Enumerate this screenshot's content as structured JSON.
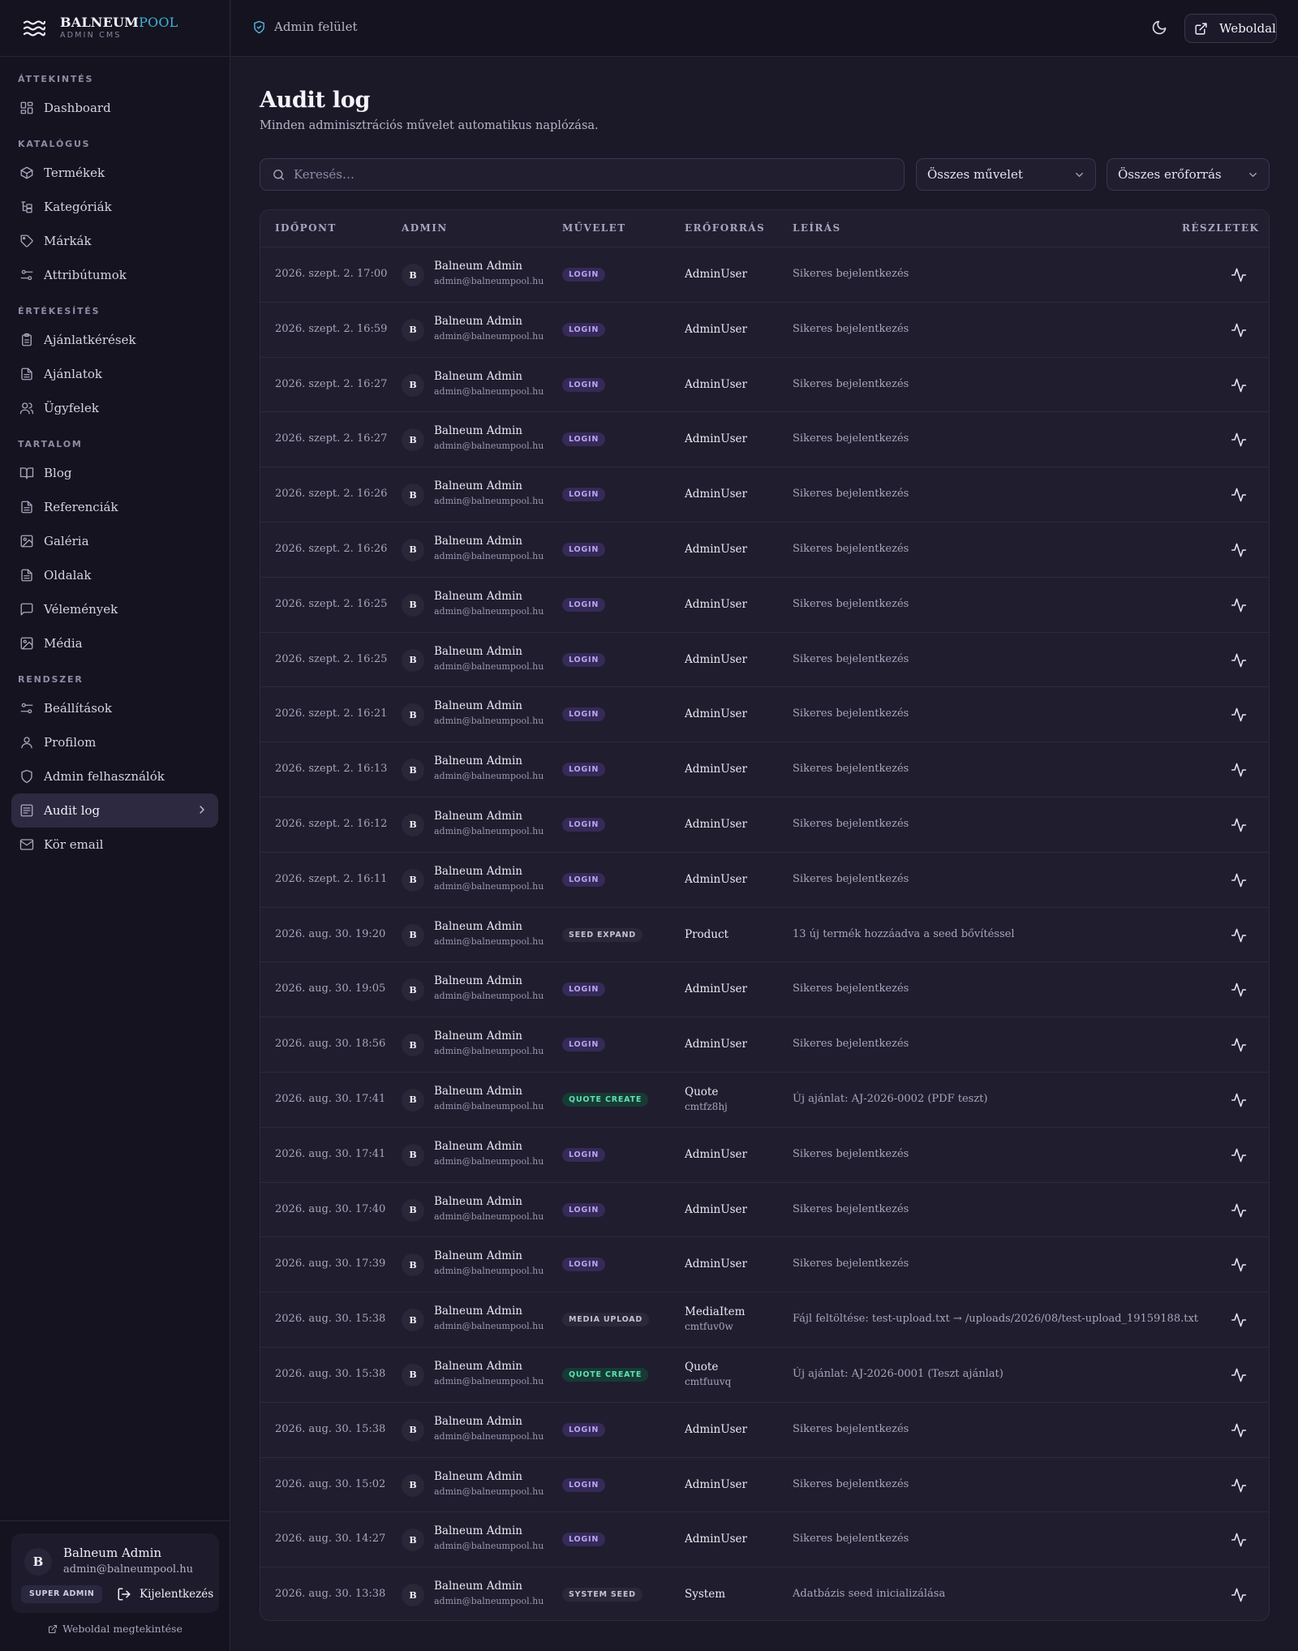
{
  "brand": {
    "name_a": "BALNEUM",
    "name_b": "POOL",
    "subtitle": "ADMIN CMS"
  },
  "sidebar": {
    "sections": [
      {
        "title": "ÁTTEKINTÉS",
        "items": [
          {
            "label": "Dashboard",
            "icon": "dashboard-icon"
          }
        ]
      },
      {
        "title": "KATALÓGUS",
        "items": [
          {
            "label": "Termékek",
            "icon": "package-icon"
          },
          {
            "label": "Kategóriák",
            "icon": "tree-icon"
          },
          {
            "label": "Márkák",
            "icon": "tag-icon"
          },
          {
            "label": "Attribútumok",
            "icon": "sliders-icon"
          }
        ]
      },
      {
        "title": "ÉRTÉKESÍTÉS",
        "items": [
          {
            "label": "Ajánlatkérések",
            "icon": "clipboard-icon"
          },
          {
            "label": "Ajánlatok",
            "icon": "file-icon"
          },
          {
            "label": "Ügyfelek",
            "icon": "users-icon"
          }
        ]
      },
      {
        "title": "TARTALOM",
        "items": [
          {
            "label": "Blog",
            "icon": "book-icon"
          },
          {
            "label": "Referenciák",
            "icon": "file-icon"
          },
          {
            "label": "Galéria",
            "icon": "image-icon"
          },
          {
            "label": "Oldalak",
            "icon": "file-icon"
          },
          {
            "label": "Vélemények",
            "icon": "chat-icon"
          },
          {
            "label": "Média",
            "icon": "image-icon"
          }
        ]
      },
      {
        "title": "RENDSZER",
        "items": [
          {
            "label": "Beállítások",
            "icon": "sliders-icon"
          },
          {
            "label": "Profilom",
            "icon": "user-icon"
          },
          {
            "label": "Admin felhasználók",
            "icon": "shield-icon"
          },
          {
            "label": "Audit log",
            "icon": "log-icon",
            "active": true
          },
          {
            "label": "Kör email",
            "icon": "mail-icon"
          }
        ]
      }
    ],
    "user": {
      "initial": "B",
      "name": "Balneum Admin",
      "email": "admin@balneumpool.hu",
      "role": "SUPER ADMIN",
      "logout_label": "Kijelentkezés"
    },
    "site_link": "Weboldal megtekintése"
  },
  "topbar": {
    "breadcrumb": "Admin felület",
    "site_button": "Weboldal"
  },
  "page": {
    "title": "Audit log",
    "subtitle": "Minden adminisztrációs művelet automatikus naplózása.",
    "search_placeholder": "Keresés…",
    "filter_action": "Összes művelet",
    "filter_resource": "Összes erőforrás"
  },
  "table": {
    "headers": {
      "time": "IDŐPONT",
      "admin": "ADMIN",
      "action": "MŰVELET",
      "resource": "ERŐFORRÁS",
      "desc": "LEÍRÁS",
      "details": "RÉSZLETEK"
    },
    "rows": [
      {
        "time": "2026. szept. 2. 17:00",
        "action": "LOGIN",
        "kind": "login",
        "resource": "AdminUser",
        "resource_id": "",
        "desc": "Sikeres bejelentkezés"
      },
      {
        "time": "2026. szept. 2. 16:59",
        "action": "LOGIN",
        "kind": "login",
        "resource": "AdminUser",
        "resource_id": "",
        "desc": "Sikeres bejelentkezés"
      },
      {
        "time": "2026. szept. 2. 16:27",
        "action": "LOGIN",
        "kind": "login",
        "resource": "AdminUser",
        "resource_id": "",
        "desc": "Sikeres bejelentkezés"
      },
      {
        "time": "2026. szept. 2. 16:27",
        "action": "LOGIN",
        "kind": "login",
        "resource": "AdminUser",
        "resource_id": "",
        "desc": "Sikeres bejelentkezés"
      },
      {
        "time": "2026. szept. 2. 16:26",
        "action": "LOGIN",
        "kind": "login",
        "resource": "AdminUser",
        "resource_id": "",
        "desc": "Sikeres bejelentkezés"
      },
      {
        "time": "2026. szept. 2. 16:26",
        "action": "LOGIN",
        "kind": "login",
        "resource": "AdminUser",
        "resource_id": "",
        "desc": "Sikeres bejelentkezés"
      },
      {
        "time": "2026. szept. 2. 16:25",
        "action": "LOGIN",
        "kind": "login",
        "resource": "AdminUser",
        "resource_id": "",
        "desc": "Sikeres bejelentkezés"
      },
      {
        "time": "2026. szept. 2. 16:25",
        "action": "LOGIN",
        "kind": "login",
        "resource": "AdminUser",
        "resource_id": "",
        "desc": "Sikeres bejelentkezés"
      },
      {
        "time": "2026. szept. 2. 16:21",
        "action": "LOGIN",
        "kind": "login",
        "resource": "AdminUser",
        "resource_id": "",
        "desc": "Sikeres bejelentkezés"
      },
      {
        "time": "2026. szept. 2. 16:13",
        "action": "LOGIN",
        "kind": "login",
        "resource": "AdminUser",
        "resource_id": "",
        "desc": "Sikeres bejelentkezés"
      },
      {
        "time": "2026. szept. 2. 16:12",
        "action": "LOGIN",
        "kind": "login",
        "resource": "AdminUser",
        "resource_id": "",
        "desc": "Sikeres bejelentkezés"
      },
      {
        "time": "2026. szept. 2. 16:11",
        "action": "LOGIN",
        "kind": "login",
        "resource": "AdminUser",
        "resource_id": "",
        "desc": "Sikeres bejelentkezés"
      },
      {
        "time": "2026. aug. 30. 19:20",
        "action": "SEED EXPAND",
        "kind": "grey",
        "resource": "Product",
        "resource_id": "",
        "desc": "13 új termék hozzáadva a seed bővítéssel"
      },
      {
        "time": "2026. aug. 30. 19:05",
        "action": "LOGIN",
        "kind": "login",
        "resource": "AdminUser",
        "resource_id": "",
        "desc": "Sikeres bejelentkezés"
      },
      {
        "time": "2026. aug. 30. 18:56",
        "action": "LOGIN",
        "kind": "login",
        "resource": "AdminUser",
        "resource_id": "",
        "desc": "Sikeres bejelentkezés"
      },
      {
        "time": "2026. aug. 30. 17:41",
        "action": "QUOTE CREATE",
        "kind": "create",
        "resource": "Quote",
        "resource_id": "cmtfz8hj",
        "desc": "Új ajánlat: AJ-2026-0002 (PDF teszt)"
      },
      {
        "time": "2026. aug. 30. 17:41",
        "action": "LOGIN",
        "kind": "login",
        "resource": "AdminUser",
        "resource_id": "",
        "desc": "Sikeres bejelentkezés"
      },
      {
        "time": "2026. aug. 30. 17:40",
        "action": "LOGIN",
        "kind": "login",
        "resource": "AdminUser",
        "resource_id": "",
        "desc": "Sikeres bejelentkezés"
      },
      {
        "time": "2026. aug. 30. 17:39",
        "action": "LOGIN",
        "kind": "login",
        "resource": "AdminUser",
        "resource_id": "",
        "desc": "Sikeres bejelentkezés"
      },
      {
        "time": "2026. aug. 30. 15:38",
        "action": "MEDIA UPLOAD",
        "kind": "grey",
        "resource": "MediaItem",
        "resource_id": "cmtfuv0w",
        "desc": "Fájl feltöltése: test-upload.txt → /uploads/2026/08/test-upload_19159188.txt"
      },
      {
        "time": "2026. aug. 30. 15:38",
        "action": "QUOTE CREATE",
        "kind": "create",
        "resource": "Quote",
        "resource_id": "cmtfuuvq",
        "desc": "Új ajánlat: AJ-2026-0001 (Teszt ajánlat)"
      },
      {
        "time": "2026. aug. 30. 15:38",
        "action": "LOGIN",
        "kind": "login",
        "resource": "AdminUser",
        "resource_id": "",
        "desc": "Sikeres bejelentkezés"
      },
      {
        "time": "2026. aug. 30. 15:02",
        "action": "LOGIN",
        "kind": "login",
        "resource": "AdminUser",
        "resource_id": "",
        "desc": "Sikeres bejelentkezés"
      },
      {
        "time": "2026. aug. 30. 14:27",
        "action": "LOGIN",
        "kind": "login",
        "resource": "AdminUser",
        "resource_id": "",
        "desc": "Sikeres bejelentkezés"
      },
      {
        "time": "2026. aug. 30. 13:38",
        "action": "SYSTEM SEED",
        "kind": "grey",
        "resource": "System",
        "resource_id": "",
        "desc": "Adatbázis seed inicializálása"
      }
    ],
    "row_admin": {
      "initial": "B",
      "name": "Balneum Admin",
      "email": "admin@balneumpool.hu"
    }
  }
}
